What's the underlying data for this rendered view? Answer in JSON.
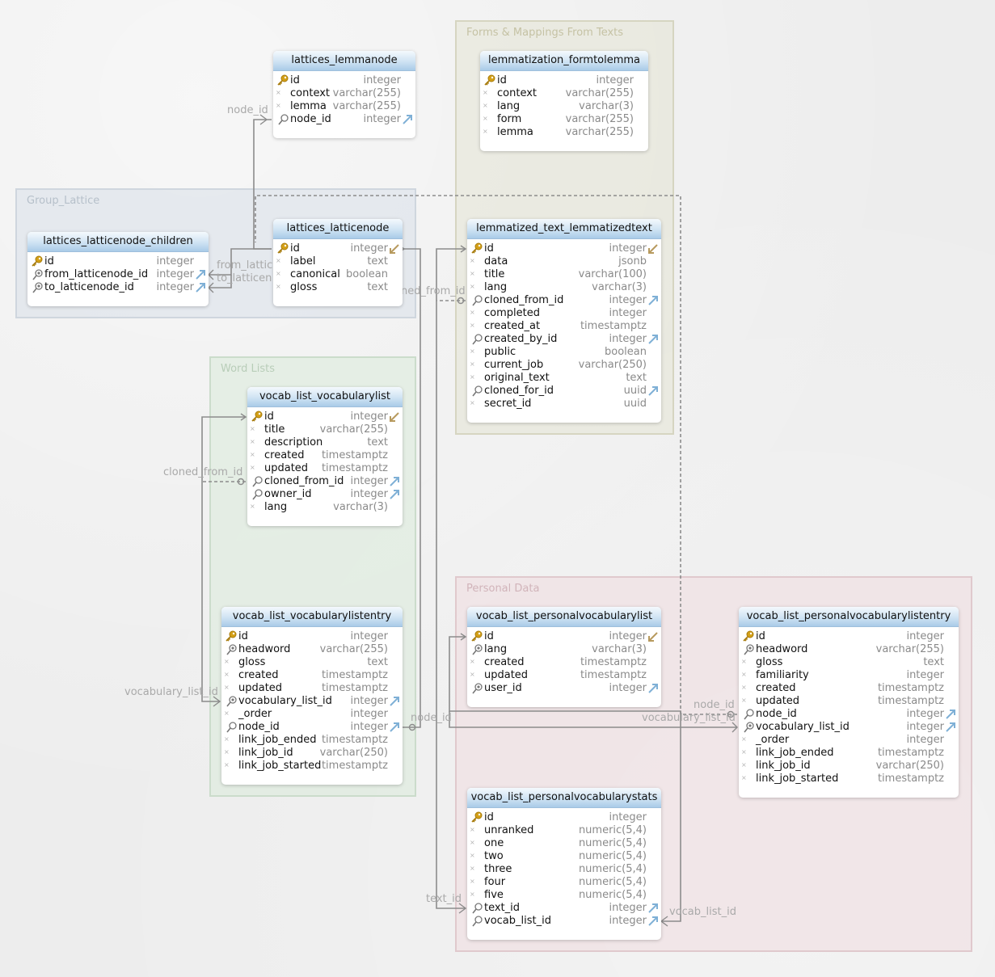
{
  "groups": {
    "forms": "Forms & Mappings From Texts",
    "lattice": "Group_Lattice",
    "words": "Word Lists",
    "personal": "Personal Data"
  },
  "tables": [
    {
      "name": "lattices_lemmanode",
      "columns": [
        {
          "name": "id",
          "type": "integer",
          "key": "pk"
        },
        {
          "name": "context",
          "type": "varchar(255)"
        },
        {
          "name": "lemma",
          "type": "varchar(255)"
        },
        {
          "name": "node_id",
          "type": "integer",
          "key": "idx",
          "fk": "out"
        }
      ]
    },
    {
      "name": "lemmatization_formtolemma",
      "columns": [
        {
          "name": "id",
          "type": "integer",
          "key": "pk"
        },
        {
          "name": "context",
          "type": "varchar(255)"
        },
        {
          "name": "lang",
          "type": "varchar(3)"
        },
        {
          "name": "form",
          "type": "varchar(255)"
        },
        {
          "name": "lemma",
          "type": "varchar(255)"
        }
      ]
    },
    {
      "name": "lattices_latticenode_children",
      "columns": [
        {
          "name": "id",
          "type": "integer",
          "key": "pk"
        },
        {
          "name": "from_latticenode_id",
          "type": "integer",
          "key": "uidx",
          "fk": "out"
        },
        {
          "name": "to_latticenode_id",
          "type": "integer",
          "key": "uidx",
          "fk": "out"
        }
      ]
    },
    {
      "name": "lattices_latticenode",
      "columns": [
        {
          "name": "id",
          "type": "integer",
          "key": "pk",
          "fk": "in"
        },
        {
          "name": "label",
          "type": "text"
        },
        {
          "name": "canonical",
          "type": "boolean"
        },
        {
          "name": "gloss",
          "type": "text"
        }
      ]
    },
    {
      "name": "lemmatized_text_lemmatizedtext",
      "columns": [
        {
          "name": "id",
          "type": "integer",
          "key": "pk",
          "fk": "in"
        },
        {
          "name": "data",
          "type": "jsonb"
        },
        {
          "name": "title",
          "type": "varchar(100)"
        },
        {
          "name": "lang",
          "type": "varchar(3)"
        },
        {
          "name": "cloned_from_id",
          "type": "integer",
          "key": "idx",
          "fk": "out"
        },
        {
          "name": "completed",
          "type": "integer"
        },
        {
          "name": "created_at",
          "type": "timestamptz"
        },
        {
          "name": "created_by_id",
          "type": "integer",
          "key": "idx",
          "fk": "out"
        },
        {
          "name": "public",
          "type": "boolean"
        },
        {
          "name": "current_job",
          "type": "varchar(250)"
        },
        {
          "name": "original_text",
          "type": "text"
        },
        {
          "name": "cloned_for_id",
          "type": "uuid",
          "key": "idx",
          "fk": "out"
        },
        {
          "name": "secret_id",
          "type": "uuid"
        }
      ]
    },
    {
      "name": "vocab_list_vocabularylist",
      "columns": [
        {
          "name": "id",
          "type": "integer",
          "key": "pk",
          "fk": "in"
        },
        {
          "name": "title",
          "type": "varchar(255)"
        },
        {
          "name": "description",
          "type": "text"
        },
        {
          "name": "created",
          "type": "timestamptz"
        },
        {
          "name": "updated",
          "type": "timestamptz"
        },
        {
          "name": "cloned_from_id",
          "type": "integer",
          "key": "idx",
          "fk": "out"
        },
        {
          "name": "owner_id",
          "type": "integer",
          "key": "idx",
          "fk": "out"
        },
        {
          "name": "lang",
          "type": "varchar(3)"
        }
      ]
    },
    {
      "name": "vocab_list_vocabularylistentry",
      "columns": [
        {
          "name": "id",
          "type": "integer",
          "key": "pk"
        },
        {
          "name": "headword",
          "type": "varchar(255)",
          "key": "uidx"
        },
        {
          "name": "gloss",
          "type": "text"
        },
        {
          "name": "created",
          "type": "timestamptz"
        },
        {
          "name": "updated",
          "type": "timestamptz"
        },
        {
          "name": "vocabulary_list_id",
          "type": "integer",
          "key": "uidx",
          "fk": "out"
        },
        {
          "name": "_order",
          "type": "integer"
        },
        {
          "name": "node_id",
          "type": "integer",
          "key": "idx",
          "fk": "out"
        },
        {
          "name": "link_job_ended",
          "type": "timestamptz"
        },
        {
          "name": "link_job_id",
          "type": "varchar(250)"
        },
        {
          "name": "link_job_started",
          "type": "timestamptz"
        }
      ]
    },
    {
      "name": "vocab_list_personalvocabularylist",
      "columns": [
        {
          "name": "id",
          "type": "integer",
          "key": "pk",
          "fk": "in"
        },
        {
          "name": "lang",
          "type": "varchar(3)",
          "key": "uidx"
        },
        {
          "name": "created",
          "type": "timestamptz"
        },
        {
          "name": "updated",
          "type": "timestamptz"
        },
        {
          "name": "user_id",
          "type": "integer",
          "key": "uidx",
          "fk": "out"
        }
      ]
    },
    {
      "name": "vocab_list_personalvocabularylistentry",
      "columns": [
        {
          "name": "id",
          "type": "integer",
          "key": "pk"
        },
        {
          "name": "headword",
          "type": "varchar(255)",
          "key": "uidx"
        },
        {
          "name": "gloss",
          "type": "text"
        },
        {
          "name": "familiarity",
          "type": "integer"
        },
        {
          "name": "created",
          "type": "timestamptz"
        },
        {
          "name": "updated",
          "type": "timestamptz"
        },
        {
          "name": "node_id",
          "type": "integer",
          "key": "idx",
          "fk": "out"
        },
        {
          "name": "vocabulary_list_id",
          "type": "integer",
          "key": "uidx",
          "fk": "out"
        },
        {
          "name": "_order",
          "type": "integer"
        },
        {
          "name": "link_job_ended",
          "type": "timestamptz"
        },
        {
          "name": "link_job_id",
          "type": "varchar(250)"
        },
        {
          "name": "link_job_started",
          "type": "timestamptz"
        }
      ]
    },
    {
      "name": "vocab_list_personalvocabularystats",
      "columns": [
        {
          "name": "id",
          "type": "integer",
          "key": "pk"
        },
        {
          "name": "unranked",
          "type": "numeric(5,4)"
        },
        {
          "name": "one",
          "type": "numeric(5,4)"
        },
        {
          "name": "two",
          "type": "numeric(5,4)"
        },
        {
          "name": "three",
          "type": "numeric(5,4)"
        },
        {
          "name": "four",
          "type": "numeric(5,4)"
        },
        {
          "name": "five",
          "type": "numeric(5,4)"
        },
        {
          "name": "text_id",
          "type": "integer",
          "key": "idx",
          "fk": "out"
        },
        {
          "name": "vocab_list_id",
          "type": "integer",
          "key": "idx",
          "fk": "out"
        }
      ]
    }
  ],
  "link_labels": {
    "node_id_lemma": "node_id",
    "from_lattic": "from_lattic",
    "to_latticen": "to_latticen",
    "ned_from_id": "ned_from_id",
    "cloned_from_id": "cloned_from_id",
    "vocabulary_list_id": "vocabulary_list_id",
    "node_id_entry": "node_id",
    "node_id_personal": "node_id",
    "vocabulary_list_id_personal": "vocabulary_list_id",
    "text_id": "text_id",
    "vocab_list_id": "vocab_list_id"
  },
  "colors": {
    "pk_key": "#d4a017",
    "fk_out_arrow": "#7fb0d6",
    "fk_in_arrow": "#b79a5e",
    "link_line": "#8c8c8c"
  }
}
